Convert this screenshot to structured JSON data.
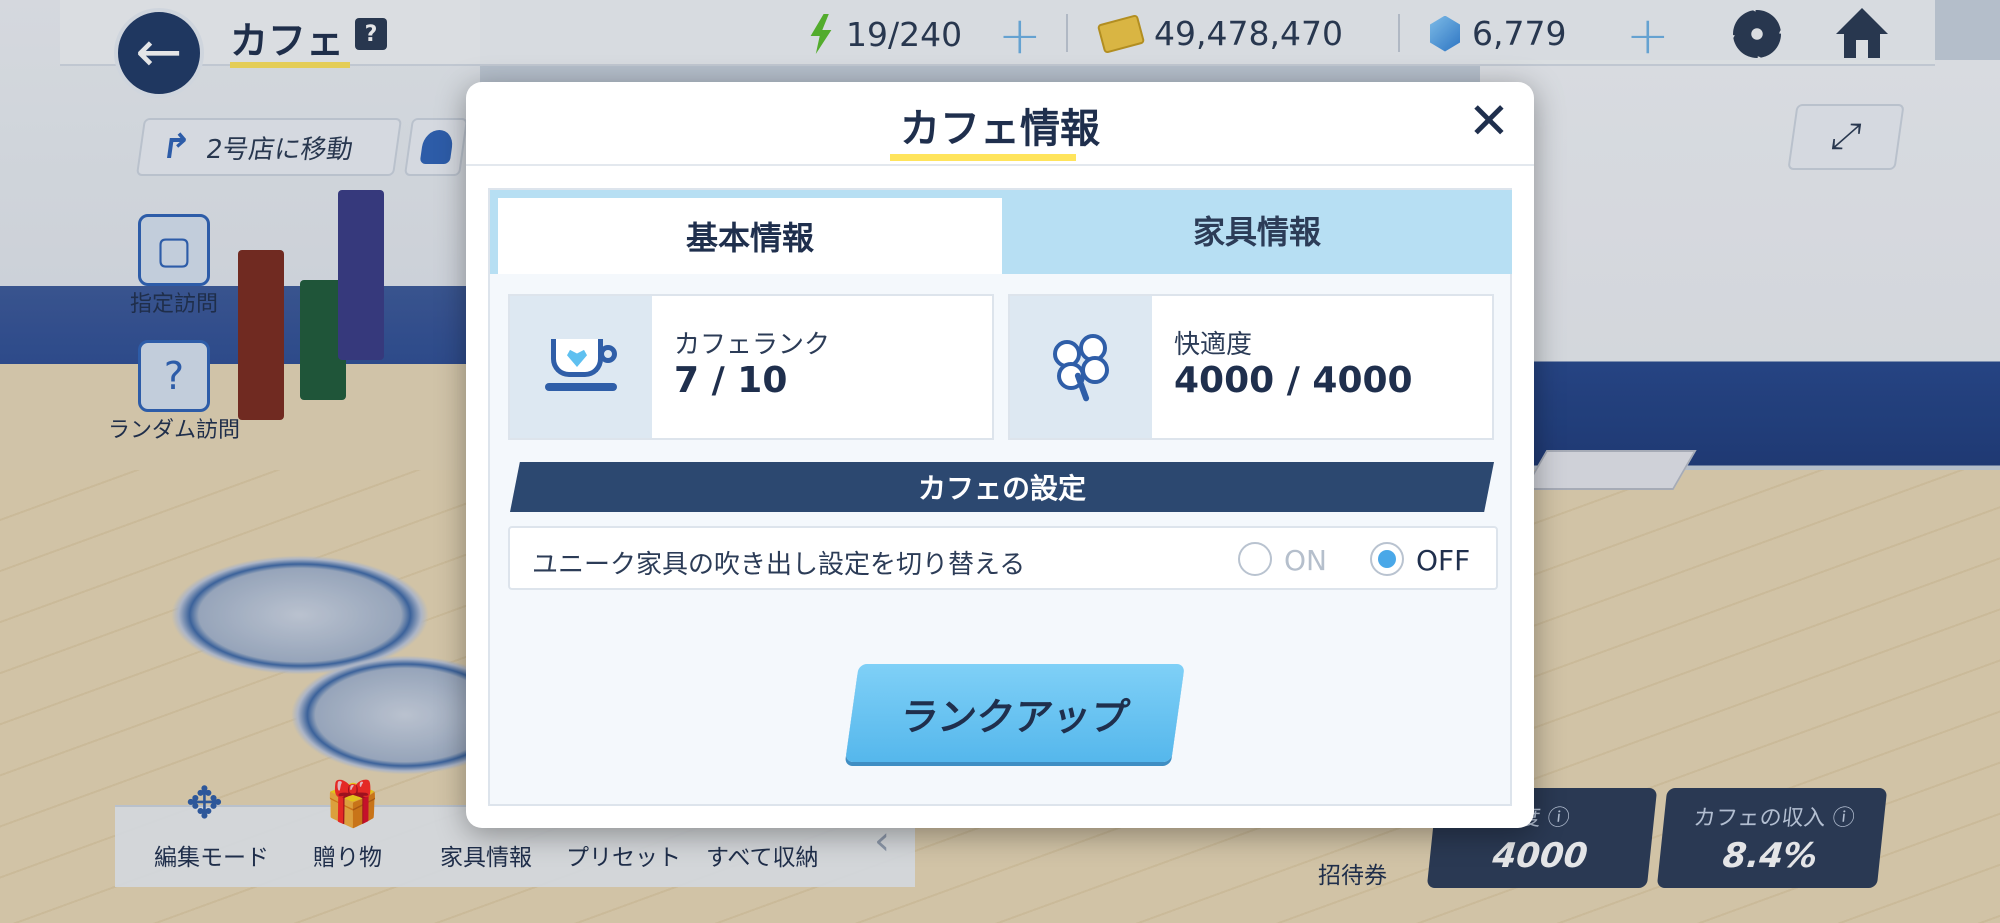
{
  "header": {
    "title": "カフェ",
    "help": "?",
    "ap": "19/240",
    "credits": "49,478,470",
    "gems": "6,779"
  },
  "left_menu": {
    "move_shop": "2号店に移動",
    "designated_visit": "指定訪問",
    "random_visit": "ランダム訪問"
  },
  "bottom_bar": {
    "items": [
      "編集モード",
      "贈り物",
      "家具情報",
      "プリセット",
      "すべて収納"
    ],
    "invite": "招待券"
  },
  "bottom_stats": {
    "comfort_label": "度 ⓘ",
    "comfort_value": "4000",
    "income_label": "カフェの収入 ⓘ",
    "income_value": "8.4%"
  },
  "modal": {
    "title": "カフェ情報",
    "close": "✕",
    "tabs": [
      "基本情報",
      "家具情報"
    ],
    "active_tab": 0,
    "cafe_rank": {
      "label": "カフェランク",
      "value": "7 / 10"
    },
    "comfort": {
      "label": "快適度",
      "value": "4000 / 4000"
    },
    "settings_header": "カフェの設定",
    "setting_row": {
      "label": "ユニーク家具の吹き出し設定を切り替える",
      "on": "ON",
      "off": "OFF",
      "selected": "OFF"
    },
    "rank_up_button": "ランクアップ"
  },
  "colors": {
    "accent_yellow": "#ffe45c",
    "navy": "#2c3c57",
    "tab_blue": "#b7dff3",
    "button_blue": "#55b7ec"
  }
}
